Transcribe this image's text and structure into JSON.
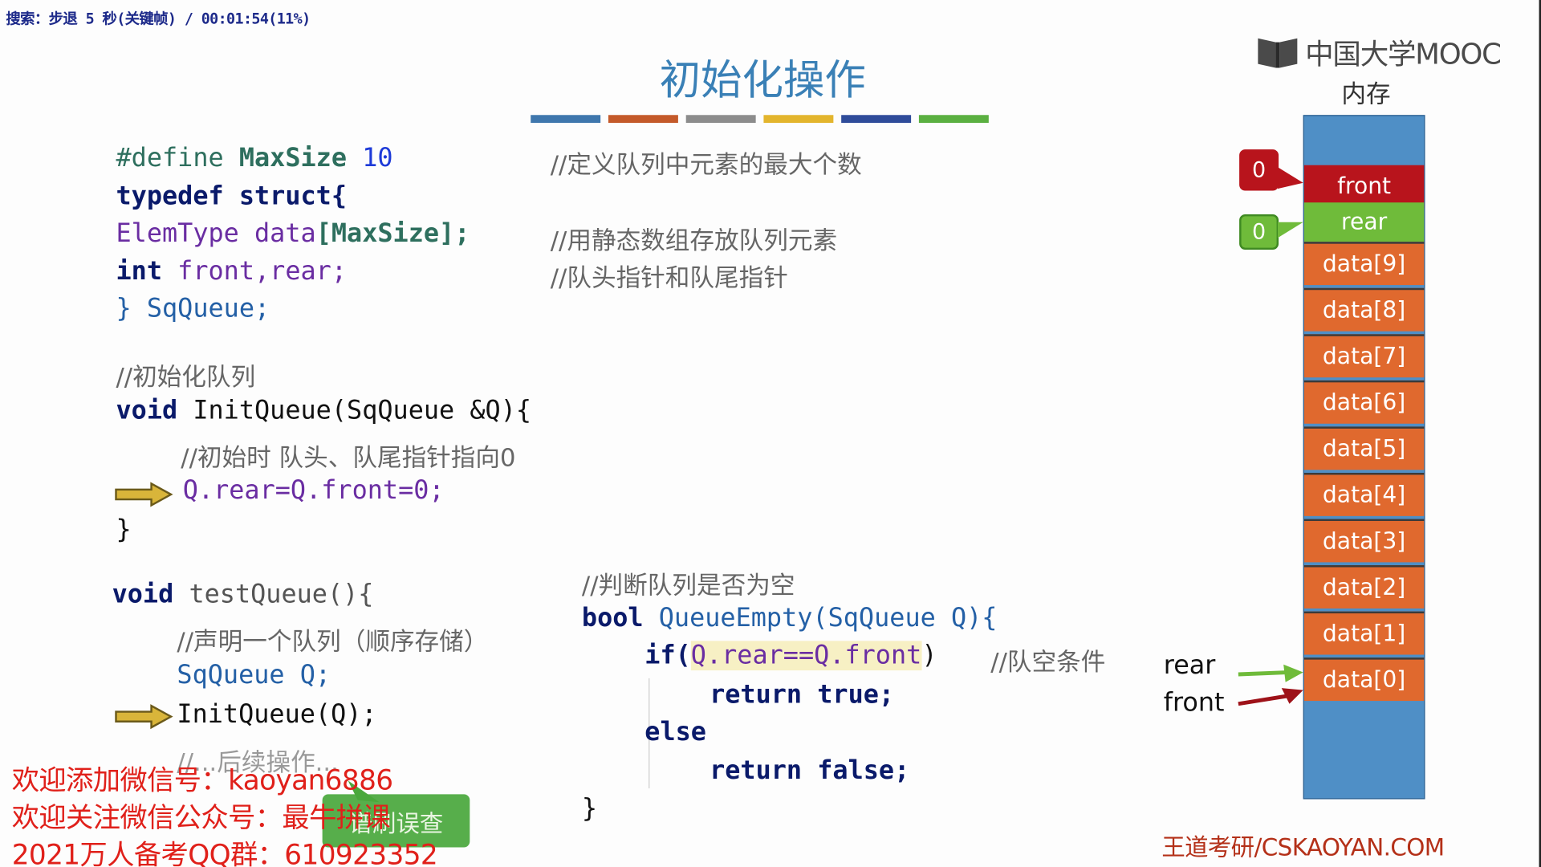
{
  "search_status": "搜索：步退 5 秒(关键帧) / 00:01:54(11%)",
  "slide": {
    "title": "初始化操作",
    "color_strip": [
      "#3f77ad",
      "#c45a2a",
      "#8c8c8c",
      "#e3b52d",
      "#2f4c9a",
      "#5bb041"
    ]
  },
  "logo": {
    "text": "中国大学MOOC",
    "icon": "open-book-icon"
  },
  "memory": {
    "title": "内存",
    "front_label": "front",
    "rear_label": "rear",
    "cells": [
      "data[9]",
      "data[8]",
      "data[7]",
      "data[6]",
      "data[5]",
      "data[4]",
      "data[3]",
      "data[2]",
      "data[1]",
      "data[0]"
    ],
    "front_value": "0",
    "rear_value": "0",
    "pointer_rear": "rear",
    "pointer_front": "front",
    "colors": {
      "front": "#b8141c",
      "rear": "#6fbb3a",
      "data": "#e0692e",
      "empty": "#4f8fc6"
    }
  },
  "code": {
    "define_kw": "#define",
    "define_name": "MaxSize",
    "define_val": "10",
    "define_comment": "//定义队列中元素的最大个数",
    "typedef": "typedef struct{",
    "elem_type": "ElemType",
    "elem_data": "data",
    "elem_size": "[MaxSize];",
    "elem_comment": "//用静态数组存放队列元素",
    "int_kw": "int",
    "int_vars": "front,rear;",
    "int_comment": "//队头指针和队尾指针",
    "struct_end": "} SqQueue;",
    "init_comment": "//初始化队列",
    "init_void": "void",
    "init_sig": "InitQueue(SqQueue &Q){",
    "init_inner_comment": "//初始时 队头、队尾指针指向0",
    "init_stmt": "Q.rear=Q.front=0;",
    "close_brace": "}",
    "test_void": "void",
    "test_sig": "testQueue(){",
    "test_comment": "//声明一个队列（顺序存储）",
    "test_decl": "SqQueue Q;",
    "test_call": "InitQueue(Q);",
    "test_more": "//...后续操作...",
    "empty_comment": "//判断队列是否为空",
    "empty_bool": "bool",
    "empty_sig": "QueueEmpty(SqQueue Q){",
    "empty_if": "if(",
    "empty_cond": "Q.rear==Q.front",
    "empty_if_close": ")",
    "empty_cond_comment": "//队空条件",
    "return_kw": "return",
    "true_kw": "true;",
    "else_kw": "else",
    "false_kw": "false;"
  },
  "footer": "王道考研/CSKAOYAN.COM",
  "promo": {
    "line1": "欢迎添加微信号：kaoyan6886",
    "line2": "欢迎关注微信公众号：最牛拼课",
    "line3": "2021万人备考QQ群：610923352"
  },
  "green_button": "谱刷误查"
}
